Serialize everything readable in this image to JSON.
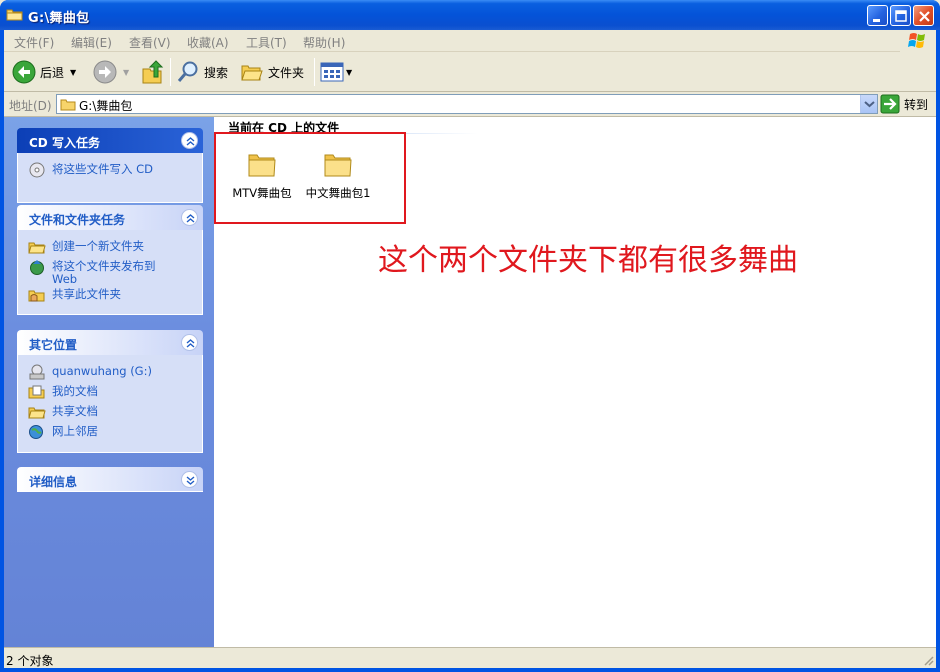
{
  "window": {
    "title": "G:\\舞曲包"
  },
  "menu": {
    "items": [
      "文件(F)",
      "编辑(E)",
      "查看(V)",
      "收藏(A)",
      "工具(T)",
      "帮助(H)"
    ]
  },
  "toolbar": {
    "back_label": "后退",
    "search_label": "搜索",
    "folders_label": "文件夹"
  },
  "address": {
    "label": "地址(D)",
    "value": "G:\\舞曲包",
    "go_label": "转到"
  },
  "taskpane": {
    "cd_tasks": {
      "title": "CD 写入任务",
      "items": [
        "将这些文件写入 CD"
      ]
    },
    "file_tasks": {
      "title": "文件和文件夹任务",
      "items": [
        "创建一个新文件夹",
        "将这个文件夹发布到 Web",
        "共享此文件夹"
      ]
    },
    "other_places": {
      "title": "其它位置",
      "items": [
        "quanwuhang (G:)",
        "我的文档",
        "共享文档",
        "网上邻居"
      ]
    },
    "details": {
      "title": "详细信息"
    }
  },
  "content": {
    "heading": "当前在 CD 上的文件",
    "files": [
      {
        "name": "MTV舞曲包",
        "icon": "folder-icon"
      },
      {
        "name": "中文舞曲包1",
        "icon": "folder-icon"
      }
    ],
    "annotation": "这个两个文件夹下都有很多舞曲"
  },
  "status": {
    "text": "2 个对象"
  },
  "colors": {
    "titlebar": "#0453d8",
    "taskpane": "#6c8edf",
    "link": "#215dc6",
    "annotation_red": "#e0181e"
  }
}
